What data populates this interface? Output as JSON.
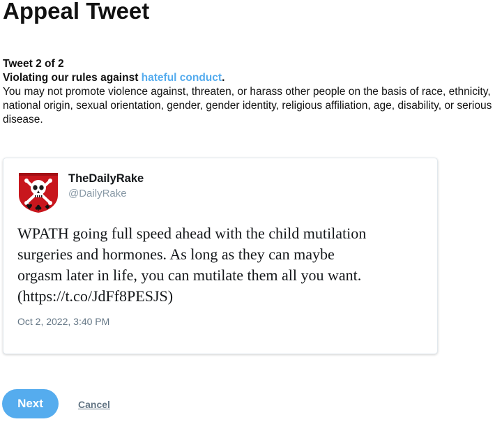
{
  "page": {
    "title": "Appeal Tweet"
  },
  "rule": {
    "counter": "Tweet 2 of 2",
    "violation_prefix": "Violating our rules against ",
    "violation_link": "hateful conduct",
    "violation_suffix": ".",
    "description": "You may not promote violence against, threaten, or harass other people on the basis of race, ethnicity, national origin, sexual orientation, gender, gender identity, religious affiliation, age, disability, or serious disease."
  },
  "tweet": {
    "author_name": "TheDailyRake",
    "author_handle": "@DailyRake",
    "avatar_icon": "skull-crossbones-shield-icon",
    "text": "WPATH going full speed ahead with the child mutilation\nsurgeries and hormones. As long as they can maybe\norgasm later in life, you can mutilate them all you want.\n(https://t.co/JdFf8PESJS)",
    "timestamp": "Oct 2, 2022, 3:40 PM"
  },
  "actions": {
    "next_label": "Next",
    "cancel_label": "Cancel"
  },
  "colors": {
    "accent": "#55acee",
    "muted_text": "#657786",
    "handle_text": "#8899a6",
    "avatar_red": "#c8161d"
  }
}
